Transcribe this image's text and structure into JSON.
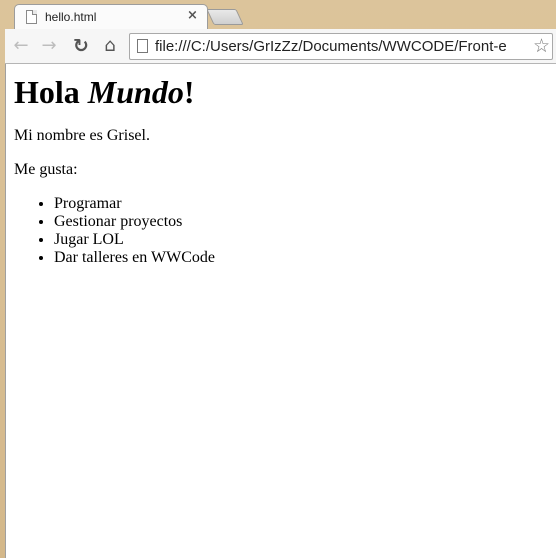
{
  "browser": {
    "tab": {
      "title": "hello.html",
      "close_glyph": "×"
    },
    "nav": {
      "back_icon": "back-arrow-icon",
      "forward_icon": "forward-arrow-icon",
      "reload_icon": "reload-icon",
      "home_icon": "home-icon",
      "back_glyph": "←",
      "forward_glyph": "→",
      "reload_glyph": "↻",
      "home_glyph": "⌂"
    },
    "address_bar": {
      "value": "file:///C:/Users/GrIzZz/Documents/WWCODE/Front-e",
      "star_glyph": "☆"
    }
  },
  "page": {
    "heading_start": "Hola ",
    "heading_emphasis": "Mundo",
    "heading_end": "!",
    "intro": "Mi nombre es Grisel.",
    "likes_label": "Me gusta:",
    "likes": [
      "Programar",
      "Gestionar proyectos",
      "Jugar LOL",
      "Dar talleres en WWCode"
    ]
  }
}
